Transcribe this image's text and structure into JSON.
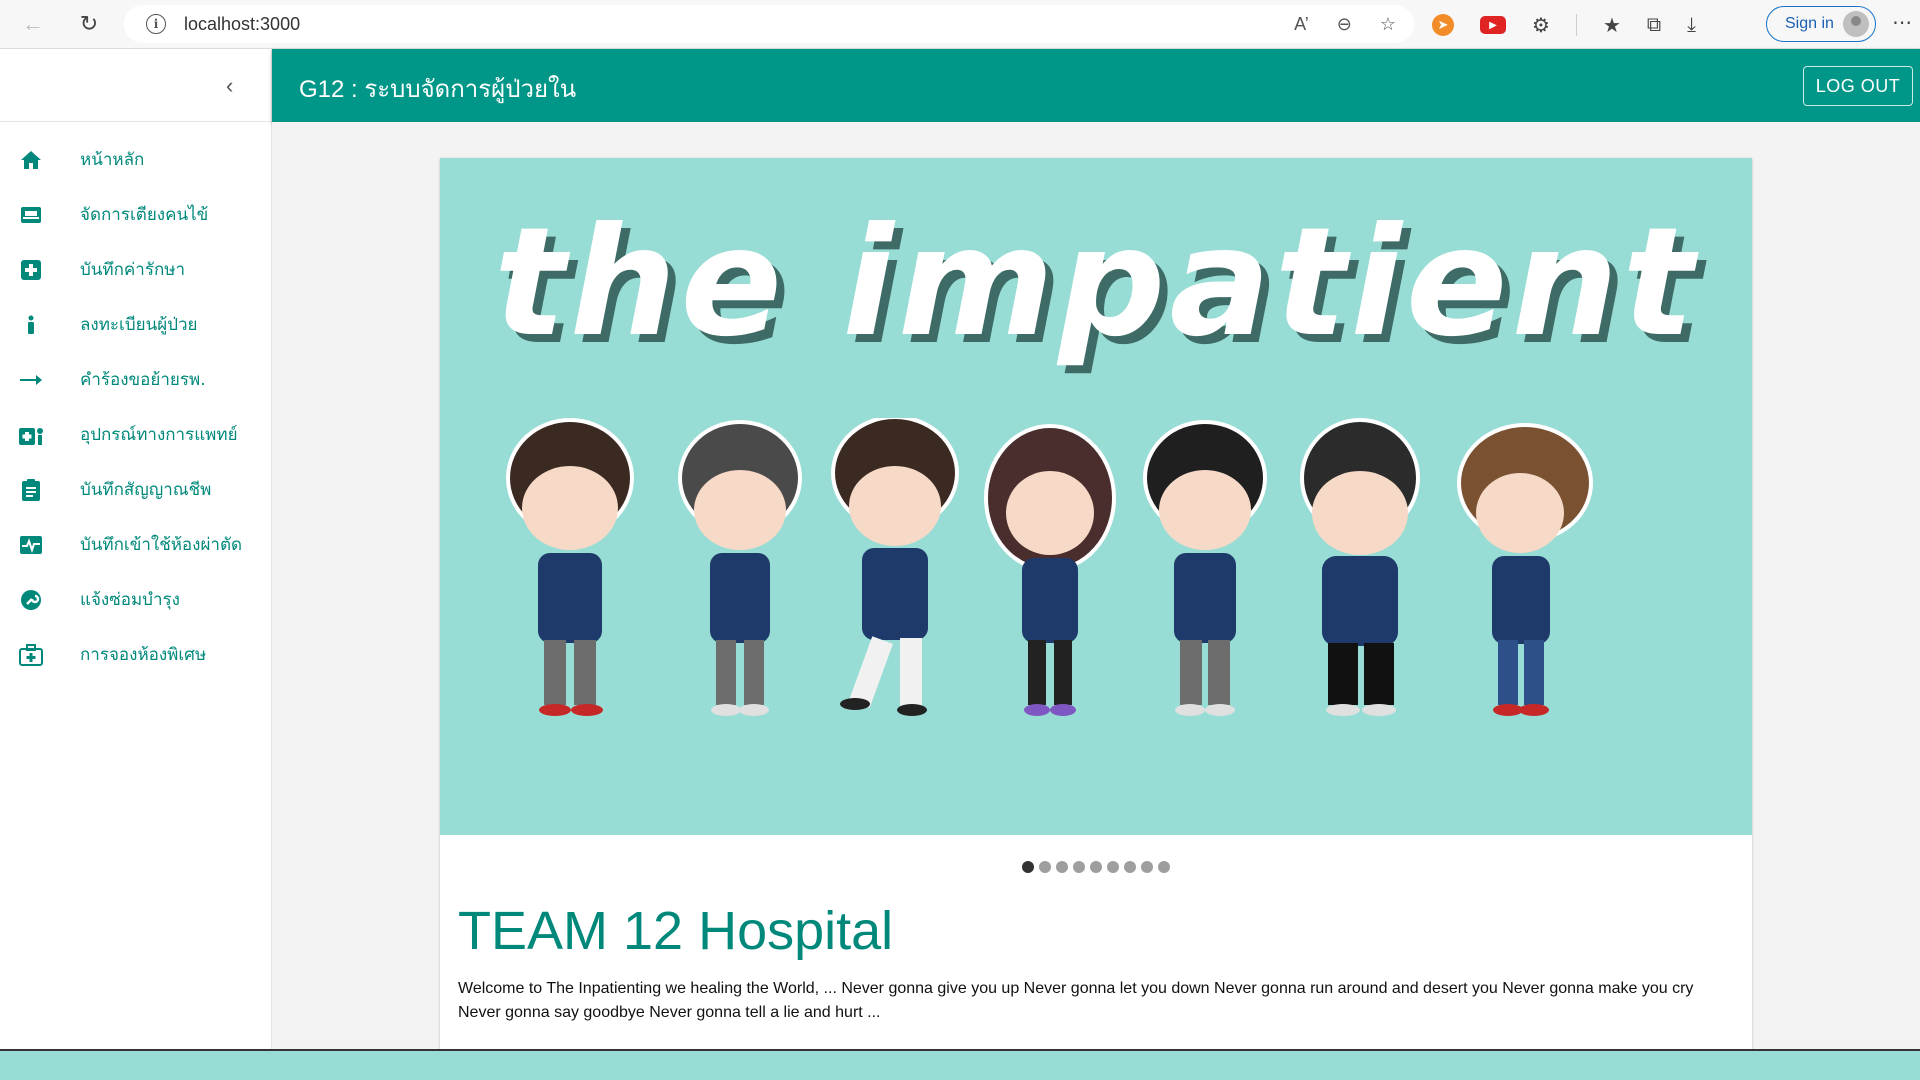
{
  "browser": {
    "url": "localhost:3000",
    "signin_label": "Sign in"
  },
  "header": {
    "title": "G12 : ระบบจัดการผู้ป่วยใน",
    "logout_label": "LOG OUT"
  },
  "sidebar": {
    "items": [
      {
        "label": "หน้าหลัก",
        "icon": "home-icon"
      },
      {
        "label": "จัดการเตียงคนไข้",
        "icon": "bed-icon"
      },
      {
        "label": "บันทึกค่ารักษา",
        "icon": "medical-plus-icon"
      },
      {
        "label": "ลงทะเบียนผู้ป่วย",
        "icon": "person-icon"
      },
      {
        "label": "คำร้องขอย้ายรพ.",
        "icon": "arrow-right-icon"
      },
      {
        "label": "อุปกรณ์ทางการแพทย์",
        "icon": "medical-equipment-icon"
      },
      {
        "label": "บันทึกสัญญาณชีพ",
        "icon": "clipboard-icon"
      },
      {
        "label": "บันทึกเข้าใช้ห้องผ่าตัด",
        "icon": "heart-monitor-icon"
      },
      {
        "label": "แจ้งซ่อมบำรุง",
        "icon": "wrench-icon"
      },
      {
        "label": "การจองห้องพิเศษ",
        "icon": "room-booking-icon"
      }
    ]
  },
  "banner": {
    "text": "the impatient",
    "background": "#98ddd5"
  },
  "carousel": {
    "total": 9,
    "active": 1
  },
  "content": {
    "title": "TEAM 12 Hospital",
    "body": "Welcome to The Inpatienting we healing the World, ... Never gonna give you up Never gonna let you down Never gonna run around and desert you Never gonna make you cry Never gonna say goodbye Never gonna tell a lie and hurt ..."
  },
  "colors": {
    "primary": "#009688",
    "accent_text": "#00897b"
  }
}
